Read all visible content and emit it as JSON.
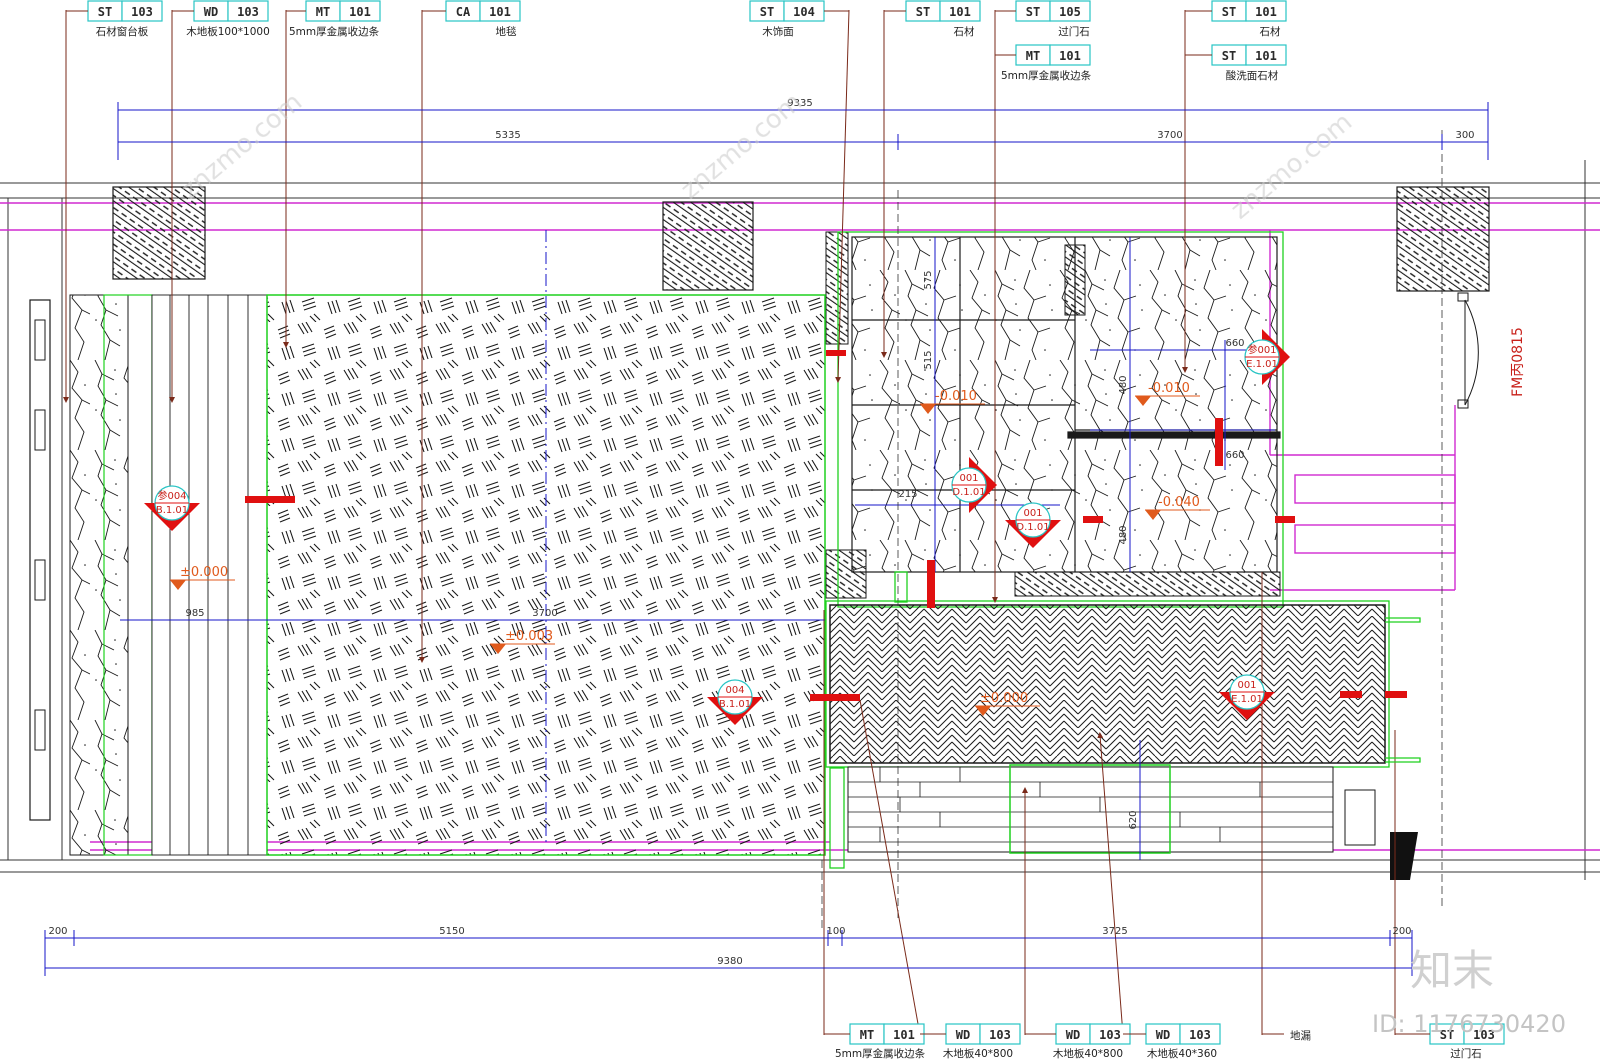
{
  "tags_top": [
    {
      "code": "ST",
      "num": "103",
      "caption": "石材窗台板"
    },
    {
      "code": "WD",
      "num": "103",
      "caption": "木地板100*1000"
    },
    {
      "code": "MT",
      "num": "101",
      "caption": "5mm厚金属收边条"
    },
    {
      "code": "CA",
      "num": "101",
      "caption": "地毯"
    },
    {
      "code": "ST",
      "num": "104",
      "caption": "木饰面"
    },
    {
      "code": "ST",
      "num": "101",
      "caption": "石材"
    },
    {
      "code": "ST",
      "num": "105",
      "caption": "过门石"
    },
    {
      "code": "MT",
      "num": "101",
      "caption": "5mm厚金属收边条"
    },
    {
      "code": "ST",
      "num": "101",
      "caption": "石材"
    },
    {
      "code": "ST",
      "num": "101",
      "caption": "酸洗面石材"
    }
  ],
  "tags_bottom": [
    {
      "code": "MT",
      "num": "101",
      "caption": "5mm厚金属收边条"
    },
    {
      "code": "WD",
      "num": "103",
      "caption": "木地板40*800"
    },
    {
      "code": "WD",
      "num": "103",
      "caption": "木地板40*800"
    },
    {
      "code": "WD",
      "num": "103",
      "caption": "木地板40*360"
    },
    {
      "code": "",
      "num": "",
      "caption": "地漏"
    },
    {
      "code": "ST",
      "num": "103",
      "caption": "过门石"
    }
  ],
  "dimensions_top": [
    "9335",
    "5335",
    "3700",
    "300"
  ],
  "dimensions_bottom": [
    "200",
    "5150",
    "100",
    "3725",
    "200",
    "9380"
  ],
  "dimensions_inner": [
    "985",
    "3700",
    "620",
    "660",
    "480",
    "660",
    "480",
    "215",
    "515",
    "575"
  ],
  "levels": [
    "±0.000",
    "±0.003",
    "-0.010",
    "-0.010",
    "-0.040",
    "±0.000"
  ],
  "callouts": [
    {
      "top": "参004",
      "bottom": "B.1.01"
    },
    {
      "top": "004",
      "bottom": "B.1.01"
    },
    {
      "top": "001",
      "bottom": "D.1.01"
    },
    {
      "top": "001",
      "bottom": "D.1.01"
    },
    {
      "top": "001",
      "bottom": "E.1.01"
    },
    {
      "top": "参001",
      "bottom": "E.1.01"
    }
  ],
  "door_label": "FM丙0815",
  "watermark": {
    "brand": "知末",
    "id": "ID: 1176730420",
    "repeat": "znzmo.com"
  },
  "colors": {
    "wall_magenta": "#d12ad1",
    "outline_green": "#1fd11f",
    "dim_blue": "#1616c8",
    "leader_brown": "#7a2a1a",
    "section_red": "#e01010",
    "level_orange": "#e05a1c",
    "tag_cyan": "#27c4c4"
  }
}
